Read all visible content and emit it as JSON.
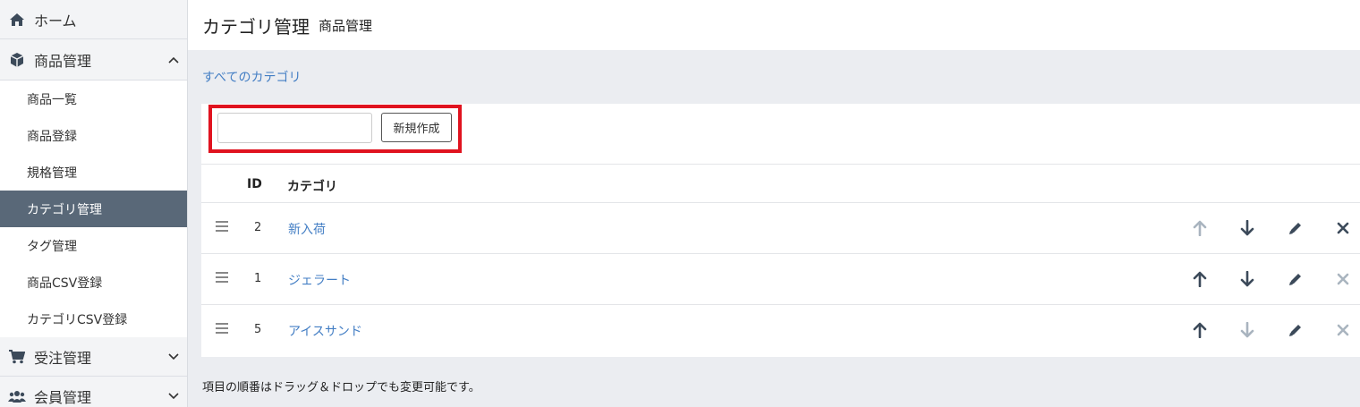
{
  "sidebar": {
    "home": {
      "label": "ホーム",
      "icon": "home-icon"
    },
    "products": {
      "label": "商品管理",
      "icon": "cube-icon",
      "children": [
        {
          "label": "商品一覧"
        },
        {
          "label": "商品登録"
        },
        {
          "label": "規格管理"
        },
        {
          "label": "カテゴリ管理",
          "active": true
        },
        {
          "label": "タグ管理"
        },
        {
          "label": "商品CSV登録"
        },
        {
          "label": "カテゴリCSV登録"
        }
      ]
    },
    "orders": {
      "label": "受注管理",
      "icon": "cart-icon"
    },
    "members": {
      "label": "会員管理",
      "icon": "users-icon"
    }
  },
  "header": {
    "title": "カテゴリ管理",
    "subtitle": "商品管理"
  },
  "breadcrumb": {
    "all_categories": "すべてのカテゴリ"
  },
  "create": {
    "input_value": "",
    "button_label": "新規作成"
  },
  "table": {
    "headers": {
      "id": "ID",
      "category": "カテゴリ"
    },
    "rows": [
      {
        "id": "2",
        "name": "新入荷",
        "up_enabled": false,
        "down_enabled": true,
        "delete_enabled": true
      },
      {
        "id": "1",
        "name": "ジェラート",
        "up_enabled": true,
        "down_enabled": true,
        "delete_enabled": false
      },
      {
        "id": "5",
        "name": "アイスサンド",
        "up_enabled": true,
        "down_enabled": false,
        "delete_enabled": false
      }
    ]
  },
  "note": "項目の順番はドラッグ＆ドロップでも変更可能です。",
  "colors": {
    "active_nav_bg": "#596878",
    "link": "#437ec4",
    "highlight_border": "#e0131f",
    "icon_enabled": "#3c4a5a",
    "icon_disabled": "#a9b4bf"
  }
}
